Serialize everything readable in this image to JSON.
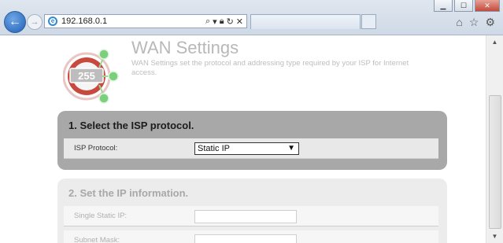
{
  "browser": {
    "address": "192.168.0.1",
    "address_icons": [
      "search-icon",
      "dropdown-icon",
      "lock-icon",
      "refresh-icon",
      "stop-icon"
    ],
    "window_buttons": [
      "minimize",
      "maximize",
      "close"
    ],
    "tool_icons": [
      "home-icon",
      "favorites-star-icon",
      "settings-gear-icon"
    ]
  },
  "logo": {
    "text": "255"
  },
  "page": {
    "title": "WAN Settings",
    "description": "WAN Settings set the protocol and addressing type required by your ISP for Internet access."
  },
  "section1": {
    "title": "1. Select the ISP protocol.",
    "isp_label": "ISP Protocol:",
    "isp_value": "Static IP"
  },
  "section2": {
    "title": "2. Set the IP information.",
    "static_ip_label": "Single Static IP:",
    "static_ip_value": "",
    "subnet_label": "Subnet Mask:",
    "subnet_value": ""
  },
  "colors": {
    "panel_active": "#a8a8a8",
    "panel_inactive": "#ececec",
    "logo_green": "#7bd17b",
    "logo_red": "#c84a3f"
  }
}
